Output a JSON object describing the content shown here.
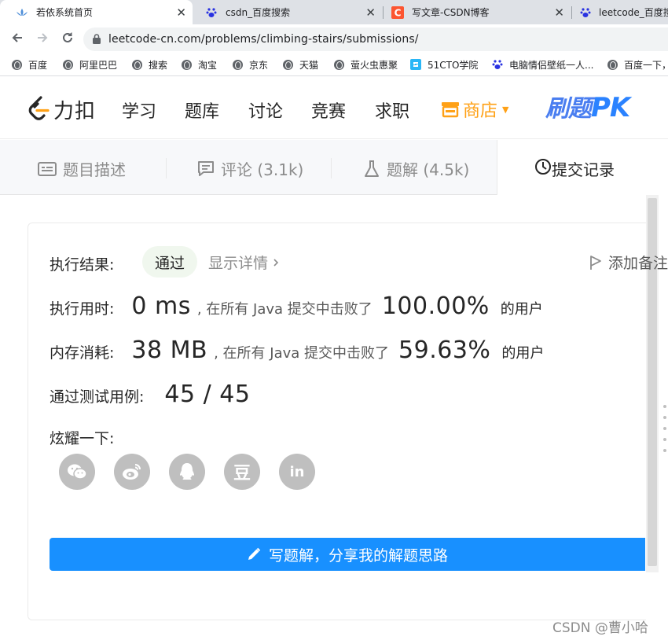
{
  "browser": {
    "tabs": [
      {
        "title": "若依系统首页",
        "icon": "lotus-icon",
        "active": true
      },
      {
        "title": "csdn_百度搜索",
        "icon": "baidu-paw-icon",
        "active": false
      },
      {
        "title": "写文章-CSDN博客",
        "icon": "csdn-c-icon",
        "active": false
      },
      {
        "title": "leetcode_百度搜",
        "icon": "baidu-paw-icon",
        "active": false
      }
    ],
    "url": "leetcode-cn.com/problems/climbing-stairs/submissions/",
    "bookmarks": [
      {
        "label": "百度",
        "icon": "globe-icon"
      },
      {
        "label": "阿里巴巴",
        "icon": "globe-icon"
      },
      {
        "label": "搜索",
        "icon": "globe-icon"
      },
      {
        "label": "淘宝",
        "icon": "globe-icon"
      },
      {
        "label": "京东",
        "icon": "globe-icon"
      },
      {
        "label": "天猫",
        "icon": "globe-icon"
      },
      {
        "label": "萤火虫惠聚",
        "icon": "globe-icon"
      },
      {
        "label": "51CTO学院",
        "icon": "51cto-icon"
      },
      {
        "label": "电脑情侣壁纸一人...",
        "icon": "baidu-paw-icon"
      },
      {
        "label": "百度一下，",
        "icon": "globe-icon"
      }
    ]
  },
  "site": {
    "logo_text": "力扣",
    "nav": [
      "学习",
      "题库",
      "讨论",
      "竞赛",
      "求职"
    ],
    "shop": "商店",
    "pk": {
      "prefix": "刷题",
      "suffix": "PK"
    }
  },
  "problem_tabs": {
    "description": "题目描述",
    "comments": "评论 (3.1k)",
    "solutions": "题解 (4.5k)",
    "submissions": "提交记录"
  },
  "result": {
    "status_label": "执行结果:",
    "status_value": "通过",
    "show_details": "显示详情",
    "add_note": "添加备注",
    "runtime_label": "执行用时:",
    "runtime_value": "0 ms",
    "runtime_mid": ", 在所有 Java 提交中击败了",
    "runtime_pct": "100.00%",
    "runtime_suffix": "的用户",
    "memory_label": "内存消耗:",
    "memory_value": "38 MB",
    "memory_mid": ", 在所有 Java 提交中击败了",
    "memory_pct": "59.63%",
    "memory_suffix": "的用户",
    "tests_label": "通过测试用例:",
    "tests_value": "45 / 45",
    "share_label": "炫耀一下:",
    "share_icons": [
      "wechat-icon",
      "weibo-icon",
      "qq-icon",
      "douban-icon",
      "linkedin-icon"
    ],
    "douban_glyph": "豆",
    "linkedin_glyph": "in",
    "write_solution": "写题解，分享我的解题思路"
  },
  "watermark": "CSDN @曹小哈"
}
